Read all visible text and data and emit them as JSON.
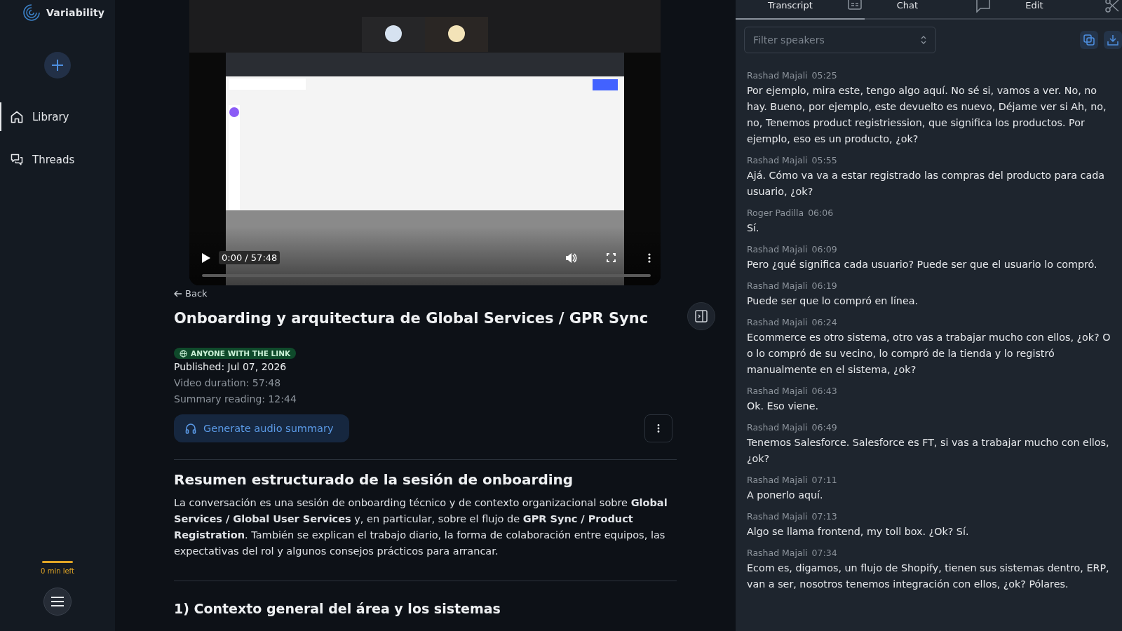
{
  "sidebar": {
    "brand": "Variability",
    "items": [
      {
        "label": "Library",
        "selected": true
      },
      {
        "label": "Threads",
        "selected": false
      }
    ],
    "usage": {
      "level": 1,
      "label": "0 min left"
    }
  },
  "video": {
    "time": "0:00 / 57:48",
    "progress": {
      "level": 0
    }
  },
  "back": "Back",
  "title": "Onboarding y arquitectura de Global Services / GPR Sync",
  "visibility": "ANYONE WITH THE LINK",
  "meta": [
    {
      "text": "Published: Jul 07, 2026",
      "kind": "primary"
    },
    {
      "text": "Video duration: 57:48",
      "kind": "muted"
    },
    {
      "text": "Summary reading: 12:44",
      "kind": "muted"
    }
  ],
  "audio_button": "Generate audio summary",
  "summary": {
    "heading": "Resumen estructurado de la sesión de onboarding",
    "paragraph": "La conversación es una sesión de onboarding técnico y de contexto organizacional sobre **Global Services / Global User Services** y, en particular, sobre el flujo de **GPR Sync / Product Registration**. También se explican el trabajo diario, la forma de colaboración entre equipos, las expectativas del rol y algunos consejos prácticos para arrancar.",
    "section": "1) Contexto general del área y los sistemas"
  },
  "tabs": [
    {
      "label": "Transcript",
      "selected": true
    },
    {
      "label": "Chat",
      "selected": false
    },
    {
      "label": "Edit",
      "selected": false
    }
  ],
  "filter": {
    "placeholder": "Filter speakers"
  },
  "transcript": [
    {
      "speaker": "Rashad Majali",
      "time": "05:25",
      "text": "Por ejemplo, mira este, tengo algo aquí. No sé si, vamos a ver. No, no hay. Bueno, por ejemplo, este devuelto es nuevo, Déjame ver si Ah, no, no, Tenemos product registriession, que significa los productos. Por ejemplo, eso es un producto, ¿ok?"
    },
    {
      "speaker": "Rashad Majali",
      "time": "05:55",
      "text": "Ajá. Cómo va va a estar registrado las compras del producto para cada usuario, ¿ok?"
    },
    {
      "speaker": "Roger Padilla",
      "time": "06:06",
      "text": "Sí."
    },
    {
      "speaker": "Rashad Majali",
      "time": "06:09",
      "text": "Pero ¿qué significa cada usuario? Puede ser que el usuario lo compró."
    },
    {
      "speaker": "Rashad Majali",
      "time": "06:19",
      "text": "Puede ser que lo compró en línea."
    },
    {
      "speaker": "Rashad Majali",
      "time": "06:24",
      "text": "Ecommerce es otro sistema, otro vas a trabajar mucho con ellos, ¿ok? O o lo compró de su vecino, lo compró de la tienda y lo registró manualmente en el sistema, ¿ok?"
    },
    {
      "speaker": "Rashad Majali",
      "time": "06:43",
      "text": "Ok. Eso viene."
    },
    {
      "speaker": "Rashad Majali",
      "time": "06:49",
      "text": "Tenemos Salesforce. Salesforce es FT, si vas a trabajar mucho con ellos, ¿ok?"
    },
    {
      "speaker": "Rashad Majali",
      "time": "07:11",
      "text": "A ponerlo aquí."
    },
    {
      "speaker": "Rashad Majali",
      "time": "07:13",
      "text": "Algo se llama frontend, my toll box. ¿Ok? Sí."
    },
    {
      "speaker": "Rashad Majali",
      "time": "07:34",
      "text": "Ecom es, digamos, un flujo de Shopify, tienen sus sistemas dentro, ERP, van a ser, nosotros tenemos integración con ellos, ¿ok? Pólares."
    }
  ]
}
